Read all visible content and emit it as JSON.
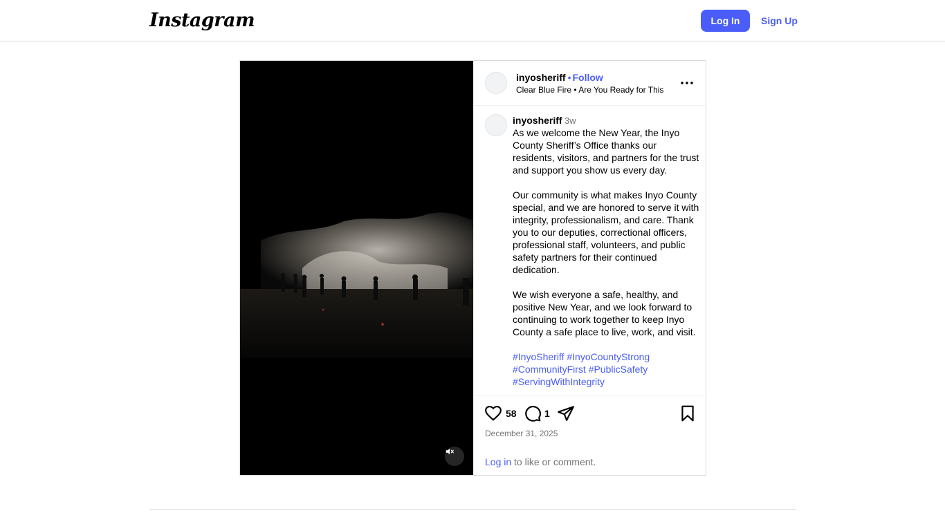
{
  "header": {
    "logo_text": "Instagram",
    "login_label": "Log In",
    "signup_label": "Sign Up",
    "accent_color": "#4a5df9"
  },
  "post": {
    "username": "inyosheriff",
    "separator": "•",
    "follow_label": "Follow",
    "audio": "Clear Blue Fire • Are You Ready for This",
    "more_icon": "more-horizontal-icon",
    "caption": {
      "username": "inyosheriff",
      "time_ago": "3w",
      "text": "As we welcome the New Year, the Inyo County Sheriff’s Office thanks our residents, visitors, and partners for the trust and support you show us every day.\n\nOur community is what makes Inyo County special, and we are honored to serve it with integrity, professionalism, and care. Thank you to our deputies, correctional officers, professional staff, volunteers, and public safety partners for their continued dedication.\n\nWe wish everyone a safe, healthy, and positive New Year, and we look forward to continuing to work together to keep Inyo County a safe place to live, work, and visit.",
      "hashtags": [
        "#InyoSheriff",
        "#InyoCountyStrong",
        "#CommunityFirst",
        "#PublicSafety",
        "#ServingWithIntegrity"
      ]
    },
    "likes": "58",
    "comments": "1",
    "date": "December 31, 2025",
    "login_prompt": {
      "link": "Log in",
      "text": " to like or comment."
    },
    "video": {
      "muted": true,
      "mute_icon": "muted-speaker-icon"
    }
  }
}
